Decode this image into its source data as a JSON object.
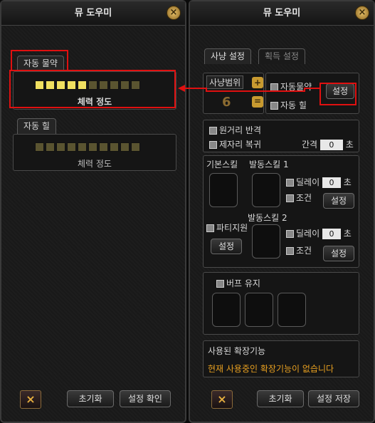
{
  "left_panel": {
    "title": "뮤 도우미",
    "close_icon": "close-icon",
    "auto_potion": {
      "tab": "자동 물약",
      "caption": "체력 정도",
      "level": 5,
      "total": 10
    },
    "auto_heal": {
      "tab": "자동 힐",
      "caption": "체력 정도",
      "level": 0,
      "total": 10
    },
    "footer": {
      "reset": "초기화",
      "confirm": "설정 확인"
    }
  },
  "right_panel": {
    "title": "뮤 도우미",
    "tabs": [
      "사냥 설정",
      "획득 설정"
    ],
    "hunt_range": {
      "label": "사냥범위",
      "value": "6"
    },
    "auto_potion_label": "자동물약",
    "auto_heal_label": "자동 힐",
    "settings_button": "설정",
    "long_range_counter": "원거리 반격",
    "return_to_spot": "제자리 복귀",
    "interval_label": "간격",
    "interval_value": "0",
    "seconds_unit": "초",
    "basic_skill_label": "기본스킬",
    "active_skill1_label": "발동스킬 1",
    "active_skill2_label": "발동스킬 2",
    "delay_label": "딜레이",
    "condition_label": "조건",
    "delay1_value": "0",
    "delay2_value": "0",
    "party_label": "파티지원",
    "buff_label": "버프 유지",
    "extensions": {
      "title": "사용된 확장기능",
      "message": "현재 사용중인 확장기능이 없습니다"
    },
    "footer": {
      "reset": "초기화",
      "save": "설정 저장"
    }
  },
  "colors": {
    "accent_yellow": "#f0e060",
    "highlight_red": "#e01010",
    "warning_text": "#e8a020"
  }
}
